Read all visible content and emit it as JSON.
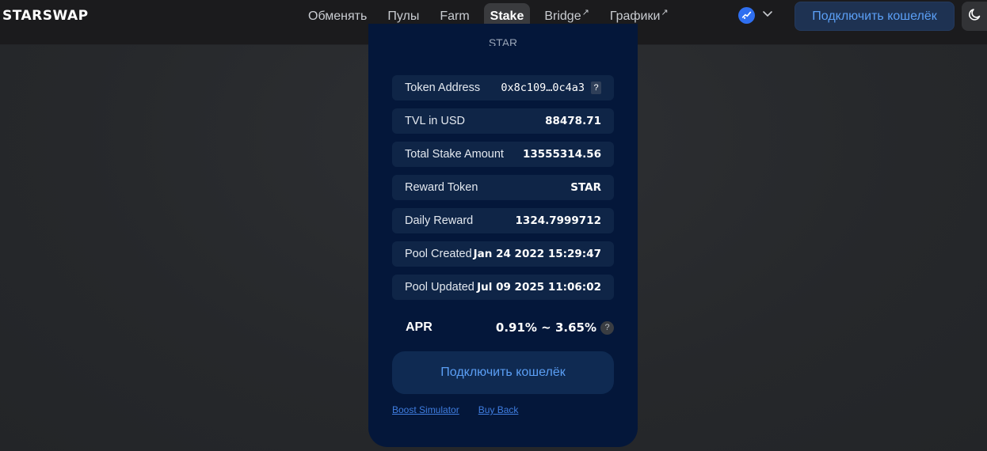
{
  "header": {
    "logo": "STARSWAP",
    "nav": [
      {
        "label": "Обменять",
        "active": false,
        "external": false
      },
      {
        "label": "Пулы",
        "active": false,
        "external": false
      },
      {
        "label": "Farm",
        "active": false,
        "external": false
      },
      {
        "label": "Stake",
        "active": true,
        "external": false
      },
      {
        "label": "Bridge",
        "active": false,
        "external": true
      },
      {
        "label": "Графики",
        "active": false,
        "external": true
      }
    ],
    "external_glyph": "↗",
    "network_icon": "starcoin-network-icon",
    "connect_label": "Подключить кошелёк",
    "theme_icon": "moon-icon"
  },
  "card": {
    "title": "STAR",
    "rows": {
      "token_address": {
        "label": "Token Address",
        "value": "0x8c109…0c4a3",
        "help": "?"
      },
      "tvl": {
        "label": "TVL in USD",
        "value": "88478.71"
      },
      "total_stake": {
        "label": "Total Stake Amount",
        "value": "13555314.56"
      },
      "reward_token": {
        "label": "Reward Token",
        "value": "STAR"
      },
      "daily_reward": {
        "label": "Daily Reward",
        "value": "1324.7999712"
      },
      "pool_created": {
        "label": "Pool Created",
        "value": "Jan 24 2022 15:29:47"
      },
      "pool_updated": {
        "label": "Pool Updated",
        "value": "Jul 09 2025 11:06:02"
      }
    },
    "apr": {
      "label": "APR",
      "value": "0.91% ~ 3.65%",
      "help": "?"
    },
    "connect_label": "Подключить кошелёк",
    "links": {
      "boost": "Boost Simulator",
      "buyback": "Buy Back"
    }
  },
  "colors": {
    "accent": "#5b9ff5",
    "card_bg": "#04173a",
    "row_bg": "#0f2547",
    "header_bg": "#1b1b1d"
  }
}
